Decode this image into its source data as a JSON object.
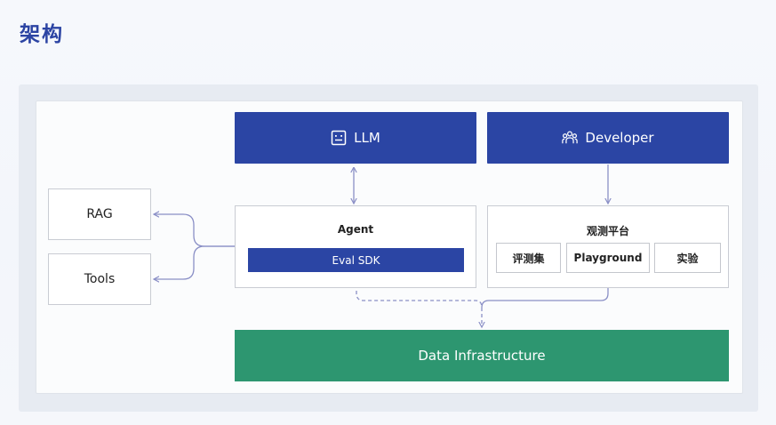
{
  "page_title": "架构",
  "llm": {
    "label": "LLM",
    "icon": "robot-face-icon"
  },
  "developer": {
    "label": "Developer",
    "icon": "people-group-icon"
  },
  "agent": {
    "label": "Agent",
    "sdk_label": "Eval SDK"
  },
  "rag": {
    "label": "RAG"
  },
  "tools": {
    "label": "Tools"
  },
  "observability": {
    "label": "观测平台",
    "items": [
      "评测集",
      "Playground",
      "实验"
    ]
  },
  "data_infra": {
    "label": "Data Infrastructure"
  },
  "colors": {
    "title": "#2c44a3",
    "primary_blue": "#2b45a4",
    "green": "#2d9670",
    "connector": "#8a8fc6"
  }
}
